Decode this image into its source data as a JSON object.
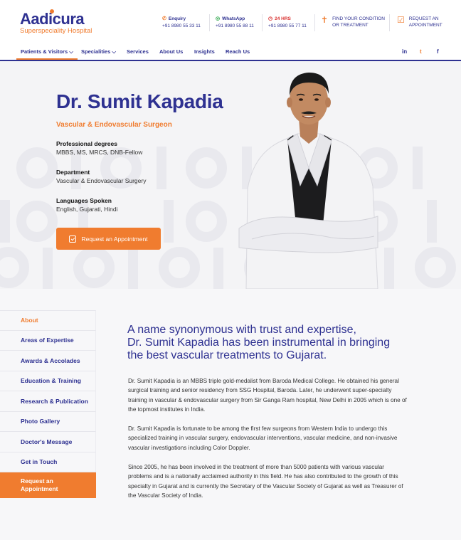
{
  "header": {
    "logo_name": "Aadicura",
    "logo_sub": "Superspeciality Hospital",
    "enquiry_label": "Enquiry",
    "enquiry_number": "+91 8980 55 33 11",
    "whatsapp_label": "WhatsApp",
    "whatsapp_number": "+91 8980 55 88 11",
    "hours_label": "24 HRS",
    "hours_number": "+91 8980 55 77 11",
    "find_line1": "FIND YOUR CONDITION",
    "find_line2": "OR TREATMENT",
    "request_line1": "REQUEST AN",
    "request_line2": "APPOINTMENT"
  },
  "nav": {
    "items": [
      "Patients & Visitors ⌵",
      "Specialities ⌵",
      "Services",
      "About Us",
      "Insights",
      "Reach Us"
    ],
    "social": [
      "in",
      "t",
      "f"
    ]
  },
  "doctor": {
    "name": "Dr. Sumit Kapadia",
    "title": "Vascular & Endovascular Surgeon",
    "degrees_heading": "Professional degrees",
    "degrees": "MBBS, MS, MRCS, DNB-Fellow",
    "department_heading": "Department",
    "department": "Vascular & Endovascular Surgery",
    "languages_heading": "Languages Spoken",
    "languages": "English, Gujarati, Hindi",
    "appointment_button": "Request an Appointment"
  },
  "sidebar": {
    "items": [
      "About",
      "Areas of Expertise",
      "Awards & Accolades",
      "Education & Training",
      "Research & Publication",
      "Photo Gallery",
      "Doctor's Message",
      "Get in Touch"
    ],
    "cta_line1": "Request an",
    "cta_line2": "Appointment"
  },
  "content": {
    "headline_line1": "A name synonymous with trust and expertise,",
    "headline_line2": "Dr. Sumit Kapadia has been instrumental in bringing",
    "headline_line3": "the best vascular treatments to Gujarat.",
    "para1": "Dr. Sumit Kapadia is an MBBS triple gold-medalist from Baroda Medical College. He obtained his general surgical training and senior residency from SSG Hospital, Baroda. Later, he underwent super-specialty training in vascular & endovascular surgery from Sir Ganga Ram hospital, New Delhi in 2005 which is one of the topmost institutes in India.",
    "para2": "Dr. Sumit Kapadia is fortunate to be among the first few surgeons from Western India to undergo this specialized training in vascular surgery, endovascular interventions, vascular medicine, and non-invasive vascular investigations including Color Doppler.",
    "para3": "Since 2005, he has been involved in the treatment of more than 5000 patients with various vascular problems and is a nationally acclaimed authority in this field. He has also contributed to the growth of this specialty in Gujarat and is currently the Secretary of the Vascular Society of Gujarat as well as Treasurer of the Vascular Society of India."
  },
  "colors": {
    "brand_blue": "#2e3191",
    "accent_orange": "#f07c2f",
    "alert_red": "#d9302f"
  },
  "icons": [
    "phone-icon",
    "whatsapp-icon",
    "clock-icon",
    "person-icon",
    "calendar-check-icon",
    "linkedin-icon",
    "twitter-icon",
    "facebook-icon"
  ]
}
